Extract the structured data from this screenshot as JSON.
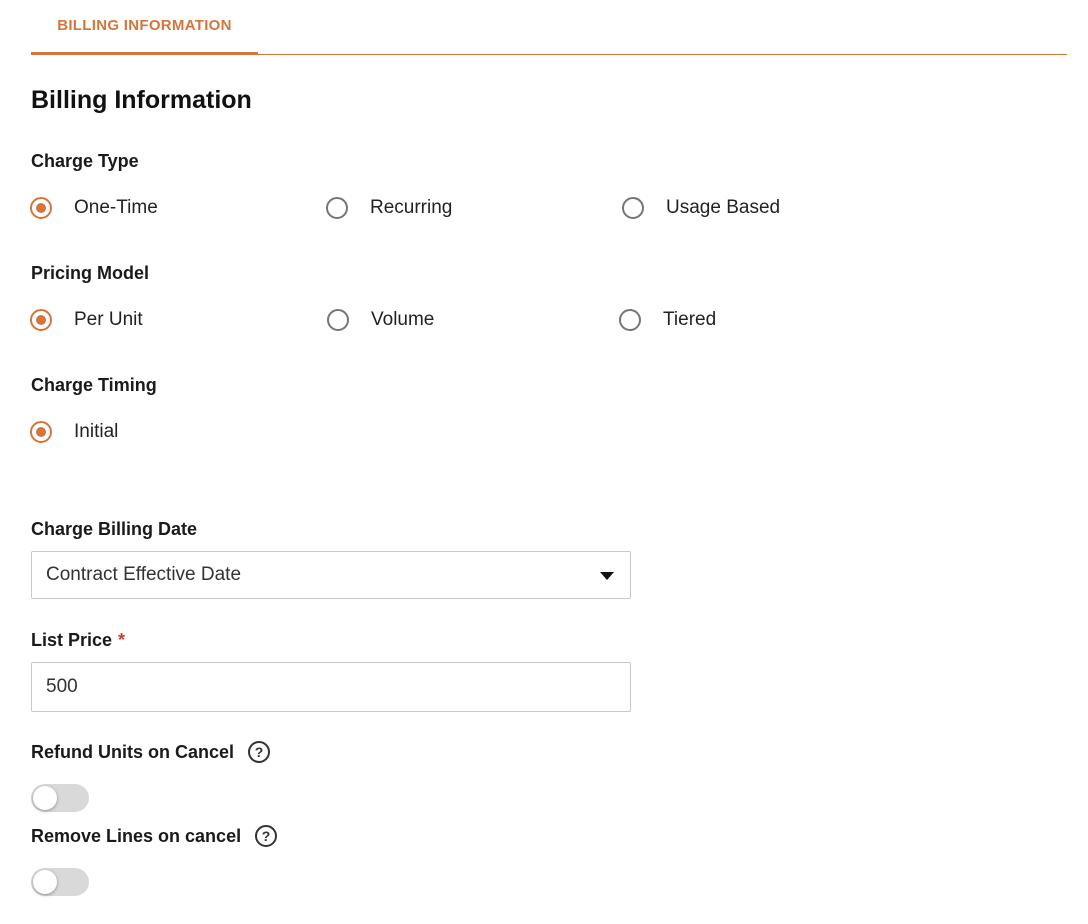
{
  "tab": {
    "label": "BILLING INFORMATION"
  },
  "section_title": "Billing Information",
  "charge_type": {
    "label": "Charge Type",
    "options": [
      "One-Time",
      "Recurring",
      "Usage Based"
    ],
    "selected": "One-Time"
  },
  "pricing_model": {
    "label": "Pricing Model",
    "options": [
      "Per Unit",
      "Volume",
      "Tiered"
    ],
    "selected": "Per Unit"
  },
  "charge_timing": {
    "label": "Charge Timing",
    "options": [
      "Initial"
    ],
    "selected": "Initial"
  },
  "charge_billing_date": {
    "label": "Charge Billing Date",
    "value": "Contract Effective Date"
  },
  "list_price": {
    "label": "List Price",
    "required_marker": "*",
    "value": "500"
  },
  "refund_units": {
    "label": "Refund Units on Cancel",
    "help": "?",
    "on": false
  },
  "remove_lines": {
    "label": "Remove Lines on cancel",
    "help": "?",
    "on": false
  },
  "colors": {
    "accent": "#d4763a",
    "required": "#c9402c",
    "toggle_off": "#d9d9d9"
  }
}
